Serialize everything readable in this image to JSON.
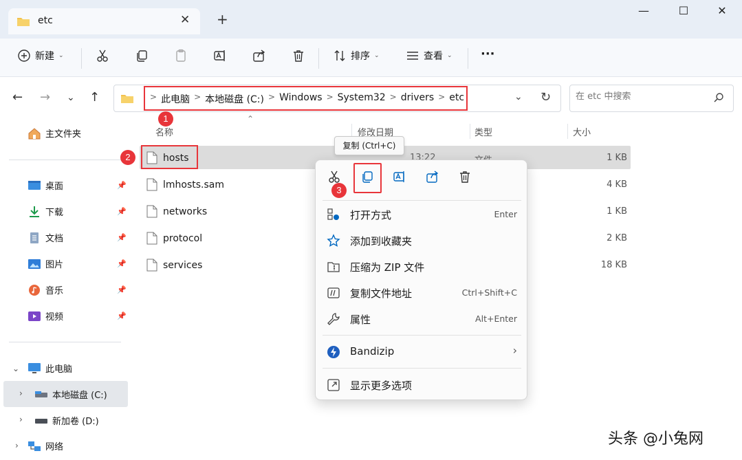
{
  "window": {
    "tab_title": "etc",
    "new_tab": "+",
    "minimize": "—",
    "maximize": "☐",
    "close": "✕"
  },
  "toolbar": {
    "new_label": "新建",
    "sort_label": "排序",
    "view_label": "查看",
    "more": "···"
  },
  "address": {
    "crumbs": [
      "此电脑",
      "本地磁盘 (C:)",
      "Windows",
      "System32",
      "drivers",
      "etc"
    ],
    "separator": ">",
    "search_placeholder": "在 etc 中搜索"
  },
  "badges": [
    "1",
    "2",
    "3"
  ],
  "sidebar": {
    "home": "主文件夹",
    "quick": [
      {
        "label": "桌面",
        "icon": "desktop-icon"
      },
      {
        "label": "下载",
        "icon": "download-icon"
      },
      {
        "label": "文档",
        "icon": "document-icon"
      },
      {
        "label": "图片",
        "icon": "picture-icon"
      },
      {
        "label": "音乐",
        "icon": "music-icon"
      },
      {
        "label": "视频",
        "icon": "video-icon"
      }
    ],
    "this_pc": "此电脑",
    "drives": [
      "本地磁盘 (C:)",
      "新加卷 (D:)"
    ],
    "network": "网络"
  },
  "columns": {
    "name": "名称",
    "modified": "修改日期",
    "type": "类型",
    "size": "大小"
  },
  "files": [
    {
      "name": "hosts",
      "size": "1 KB",
      "selected": true
    },
    {
      "name": "lmhosts.sam",
      "size": "4 KB"
    },
    {
      "name": "networks",
      "size": "1 KB"
    },
    {
      "name": "protocol",
      "size": "2 KB"
    },
    {
      "name": "services",
      "size": "18 KB"
    }
  ],
  "hosts_partial": {
    "modified": "13:22",
    "type": "文件"
  },
  "tooltip": "复制 (Ctrl+C)",
  "context_menu": {
    "items": [
      {
        "label": "打开方式",
        "shortcut": "Enter"
      },
      {
        "label": "添加到收藏夹",
        "shortcut": ""
      },
      {
        "label": "压缩为 ZIP 文件",
        "shortcut": ""
      },
      {
        "label": "复制文件地址",
        "shortcut": "Ctrl+Shift+C"
      },
      {
        "label": "属性",
        "shortcut": "Alt+Enter"
      }
    ],
    "bandizip": "Bandizip",
    "more_options": "显示更多选项"
  },
  "watermark": "头条 @小兔网",
  "colors": {
    "accent": "#0067c0",
    "highlight": "#e8353a",
    "folder": "#f2c14e"
  }
}
